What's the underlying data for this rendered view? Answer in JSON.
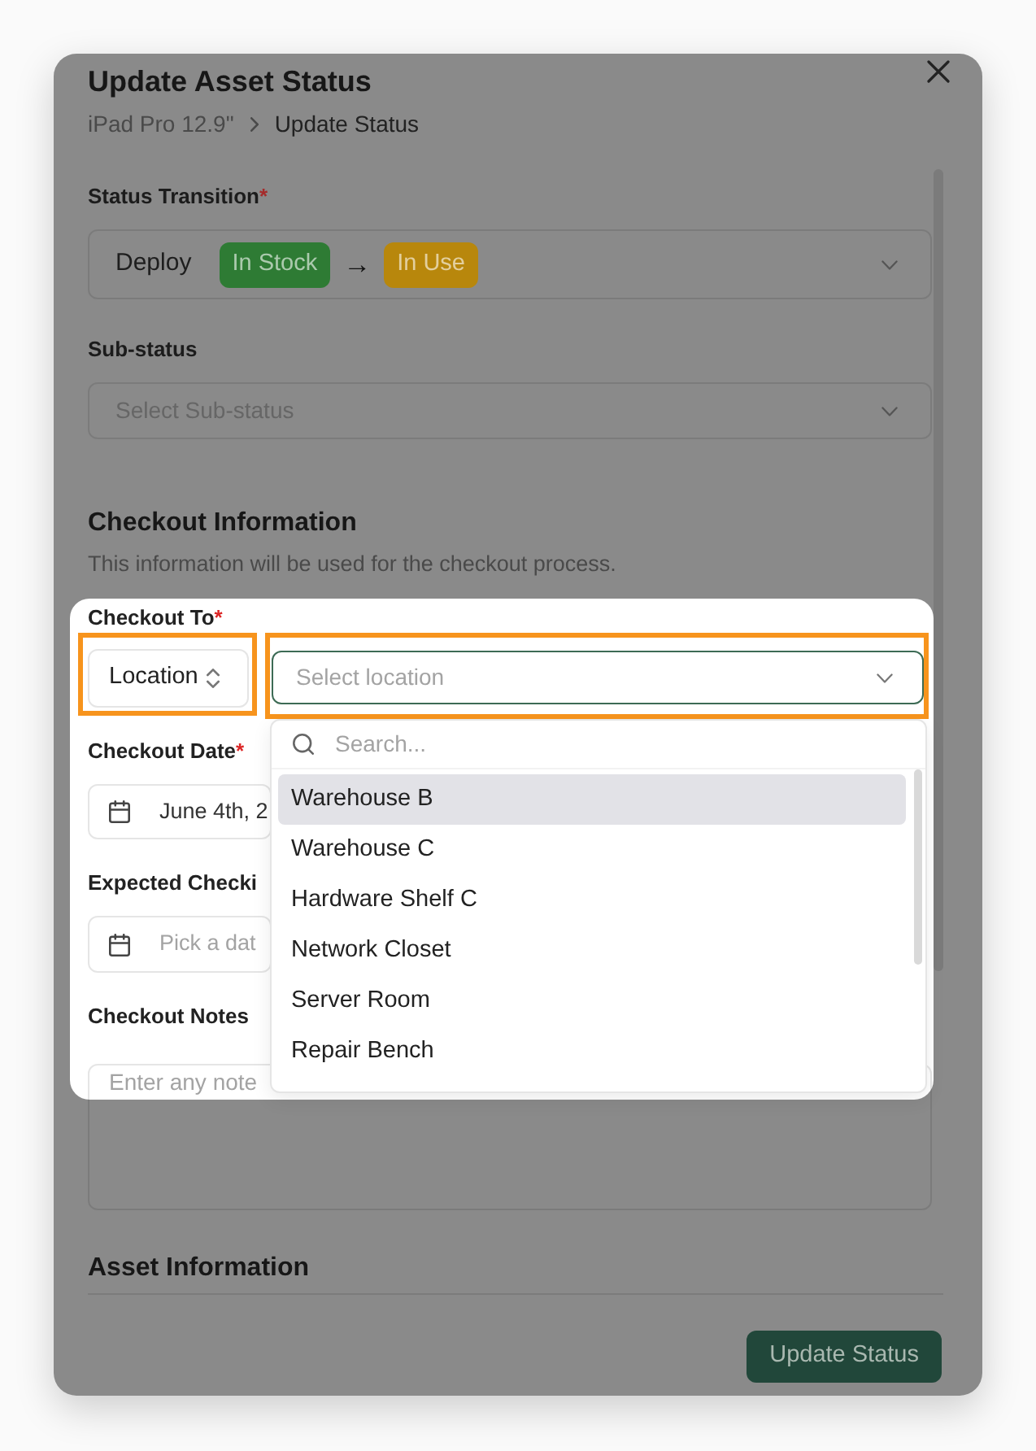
{
  "dialog": {
    "title": "Update Asset Status",
    "breadcrumb": [
      "iPad Pro 12.9\"",
      "Update Status"
    ]
  },
  "tour": {
    "spotlight": true
  },
  "status_transition": {
    "label": "Status Transition",
    "required_mark": "*",
    "action": "Deploy",
    "badges": [
      {
        "label": "In Stock",
        "color": "#2e7b34"
      },
      {
        "label": "In Use",
        "color": "#b8870c"
      }
    ],
    "arrow": "→"
  },
  "sub_status": {
    "label": "Sub-status",
    "placeholder": "Select Sub-status"
  },
  "checkout_section": {
    "title": "Checkout Information",
    "description": "This information will be used for the checkout process."
  },
  "checkout_to": {
    "label": "Checkout To",
    "required_mark": "*",
    "type_select": {
      "value": "Location",
      "highlighted": true
    },
    "location_select": {
      "placeholder": "Select location",
      "highlighted": true,
      "expanded": true,
      "search_placeholder": "Search...",
      "options": [
        {
          "label": "Warehouse B",
          "selected": true
        },
        {
          "label": "Warehouse C",
          "selected": false
        },
        {
          "label": "Hardware Shelf C",
          "selected": false
        },
        {
          "label": "Network Closet",
          "selected": false
        },
        {
          "label": "Server Room",
          "selected": false
        },
        {
          "label": "Repair Bench",
          "selected": false
        }
      ]
    }
  },
  "checkout_date": {
    "label": "Checkout Date",
    "required_mark": "*",
    "value": "June 4th, 2"
  },
  "expected_checkin": {
    "label": "Expected Checki",
    "placeholder": "Pick a dat"
  },
  "checkout_notes": {
    "label": "Checkout Notes",
    "placeholder": "Enter any note"
  },
  "asset_section": {
    "title": "Asset Information"
  },
  "footer": {
    "submit_button": "Update Status"
  }
}
